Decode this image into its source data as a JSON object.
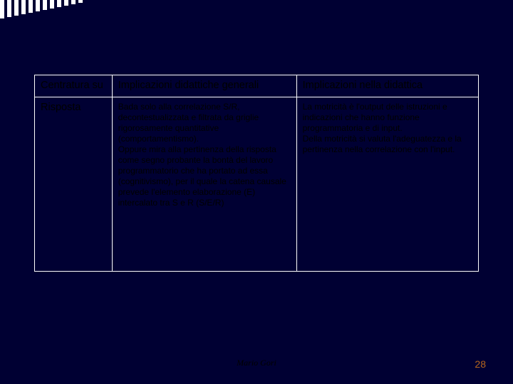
{
  "header": {
    "col1": "Centratura su",
    "col2": "Implicazioni didattiche generali",
    "col3": "Implicazioni nella didattica"
  },
  "row": {
    "label": "Risposta",
    "general": "Bada solo alla correlazione S/R, decontestualizzata e filtrata da griglie rigorosamente quantitative (comportamentismo).\nOppure mira alla pertinenza della risposta come segno probante la bontà del lavoro programmatorio che ha portato ad essa (cognitivismo), per il quale la catena causale prevede l'elemento elaborazione (E) intercalato tra S e R (S/E/R)",
    "didactic": "La motricità è l'output delle istruzioni e indicazioni che hanno funzione programmatoria e di input.\nDella motricità si valuta l'adeguatezza e la pertinenza nella correlazione con l'input."
  },
  "footer": {
    "author": "Mario Gori",
    "page": "28"
  }
}
